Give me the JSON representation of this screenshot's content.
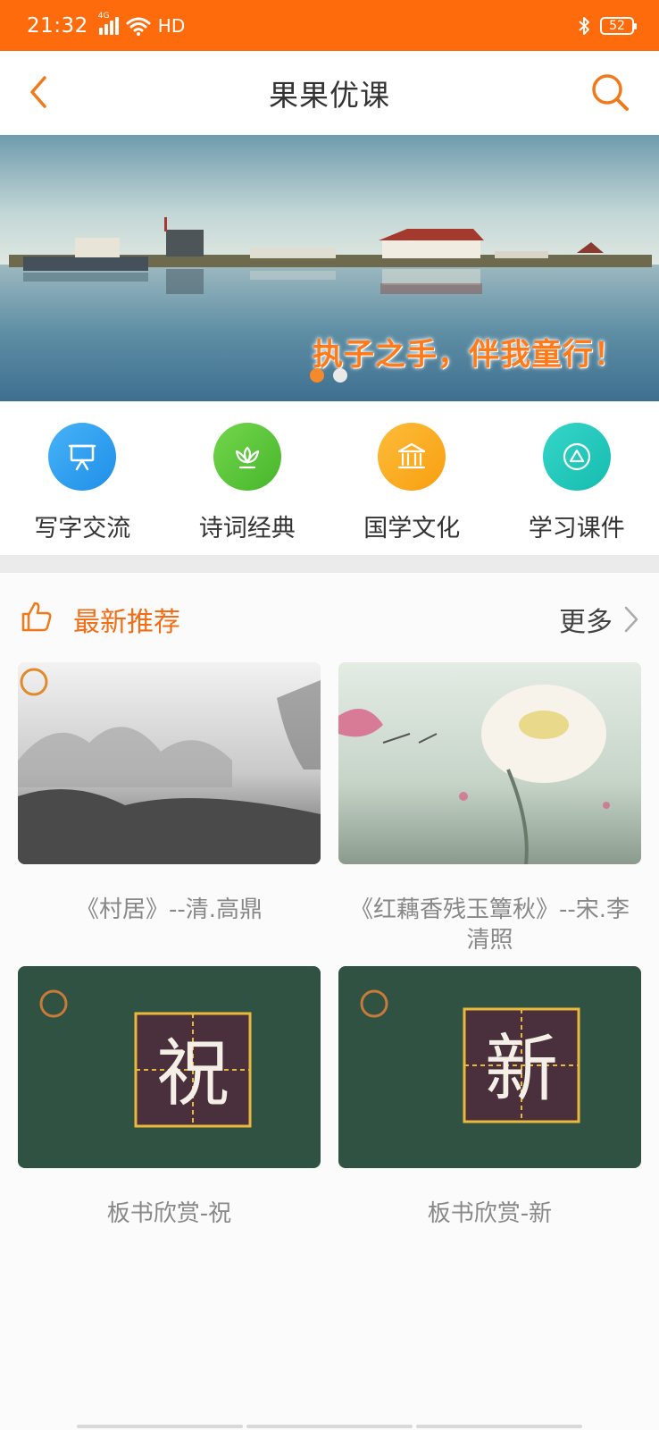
{
  "status_bar": {
    "time": "21:32",
    "network": "4G",
    "hd": "HD",
    "battery": "52"
  },
  "header": {
    "title": "果果优课"
  },
  "banner": {
    "slogan": "执子之手，伴我童行！",
    "slides": 2,
    "active_slide": 1
  },
  "categories": [
    {
      "label": "写字交流",
      "icon": "presentation-board-icon",
      "color": "#2f9df2"
    },
    {
      "label": "诗词经典",
      "icon": "lotus-icon",
      "color": "#5cc83a"
    },
    {
      "label": "国学文化",
      "icon": "temple-icon",
      "color": "#fbab20"
    },
    {
      "label": "学习课件",
      "icon": "triangle-play-icon",
      "color": "#22c9bd"
    }
  ],
  "recommend": {
    "title": "最新推荐",
    "more": "更多",
    "items": [
      {
        "title": "《村居》--清.高鼎"
      },
      {
        "title": "《红藕香残玉簟秋》--宋.李清照"
      },
      {
        "title": "板书欣赏-祝",
        "char": "祝"
      },
      {
        "title": "板书欣赏-新",
        "char": "新"
      }
    ]
  },
  "colors": {
    "accent": "#fe6b0c",
    "section_title": "#f26d14"
  }
}
